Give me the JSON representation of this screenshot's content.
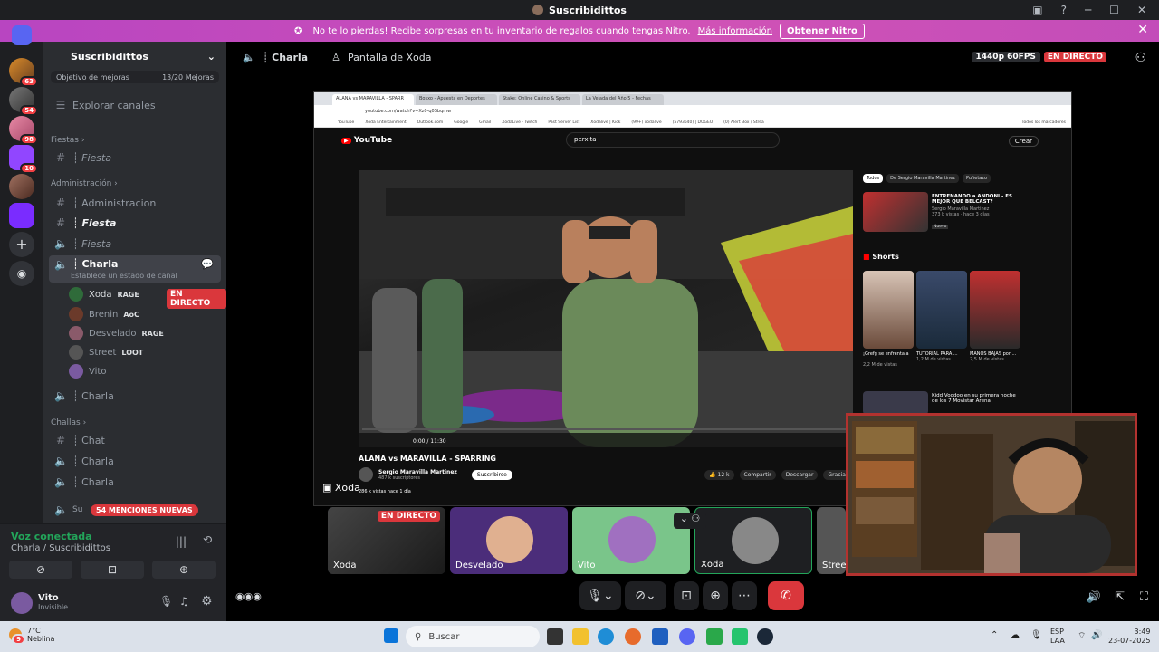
{
  "window": {
    "title": "Suscribidittos"
  },
  "banner": {
    "text": "¡No te lo pierdas! Recibe sorpresas en tu inventario de regalos cuando tengas Nitro.",
    "link": "Más información",
    "button": "Obtener Nitro"
  },
  "rail": {
    "badges": [
      "63",
      "54",
      "98",
      "10"
    ]
  },
  "sidebar": {
    "server_name": "Suscribidittos",
    "goal_label": "Objetivo de mejoras",
    "goal_value": "13/20 Mejoras",
    "explore": "Explorar canales",
    "categories": {
      "fiestas": "Fiestas",
      "administracion": "Administración",
      "challas": "Challas"
    },
    "channels": {
      "fiesta1": "┊ Fiesta",
      "administracion": "┊ Administracion",
      "fiesta2": "┊ Fiesta",
      "fiesta3": "┊ Fiesta",
      "charla_active": "┊ Charla",
      "charla_status": "Establece un estado de canal",
      "charla2": "┊ Charla",
      "chat": "┊ Chat",
      "charla3": "┊ Charla",
      "charla4": "┊ Charla",
      "su": "Su"
    },
    "live_badge": "EN DIRECTO",
    "mentions": "54 MENCIONES NUEVAS",
    "users": [
      {
        "name": "Xoda",
        "tag": "RAGE"
      },
      {
        "name": "Brenin",
        "tag": "AoC"
      },
      {
        "name": "Desvelado",
        "tag": "RAGE"
      },
      {
        "name": "Street",
        "tag": "LOOT"
      },
      {
        "name": "Vito",
        "tag": ""
      }
    ]
  },
  "voice": {
    "status": "Voz conectada",
    "location": "Charla / Suscribidittos"
  },
  "userbar": {
    "name": "Vito",
    "status": "Invisible"
  },
  "header": {
    "channel": "┊ Charla",
    "screen": "Pantalla de Xoda",
    "quality": "1440p 60FPS",
    "live": "EN DIRECTO"
  },
  "browser": {
    "tabs": [
      "ALANA vs MARAVILLA - SPARR",
      "Bosxo - Apuesta en Deportes",
      "Stake: Online Casino & Sports",
      "La Velada del Año 5 - Fechas"
    ],
    "url": "youtube.com/watch?v=Xz0-q0Sbqmw",
    "bookmarks": [
      "YouTube",
      "Xoda Entertainment",
      "Outlook.com",
      "Google",
      "Gmail",
      "XodaLive - Twitch",
      "Past Server List",
      "Xodalive | Kick",
      "(99+) xodalive",
      "(5793640) | DOGEU",
      "(0) Alert Box / Strea"
    ],
    "bookmarks_right": "Todos los marcadores",
    "search": "perxita",
    "create": "Crear",
    "video_title": "ALANA vs MARAVILLA - SPARRING",
    "channel": "Sergio Maravilla Martinez",
    "subs": "487 k suscriptores",
    "subscribe": "Suscribirse",
    "likes": "12 k",
    "share": "Compartir",
    "download": "Descargar",
    "thanks": "Gracias",
    "time": "0:00 / 11:30",
    "views": "286 k vistas hace 1 día",
    "chips": [
      "Todos",
      "De Sergio Maravilla Martinez",
      "Puñetazo"
    ],
    "rec1_title": "ENTRENANDO a ANDONI - ES MEJOR QUE BELCAST?",
    "rec1_meta": "Sergio Maravilla Martinez",
    "rec1_views": "373 k vistas · hace 3 días",
    "rec1_new": "Nuevo",
    "shorts": "Shorts",
    "short_titles": [
      "¡Grefg se enfrenta a ...",
      "TUTORIAL PARA ...",
      "MANOS BAJAS por ..."
    ],
    "short_views": [
      "2,2 M de vistas",
      "1,2 M de vistas",
      "2,5 M de vistas"
    ],
    "rec2_title": "Kidd Voodoo en su primera noche de los 7 Movistar Arena"
  },
  "stream_label": "Xoda",
  "tiles": [
    {
      "label": "Xoda",
      "live": "EN DIRECTO"
    },
    {
      "label": "Desvelado"
    },
    {
      "label": "Vito"
    },
    {
      "label": "Xoda"
    },
    {
      "label": "Stree"
    }
  ],
  "taskbar": {
    "weather_temp": "7°C",
    "weather_desc": "Neblina",
    "weather_badge": "9",
    "search": "Buscar",
    "lang1": "ESP",
    "lang2": "LAA",
    "time": "3:49",
    "date": "23-07-2025"
  },
  "colors": {
    "live": "#da373c",
    "nitro": "#c34db9",
    "green": "#23a55a"
  }
}
